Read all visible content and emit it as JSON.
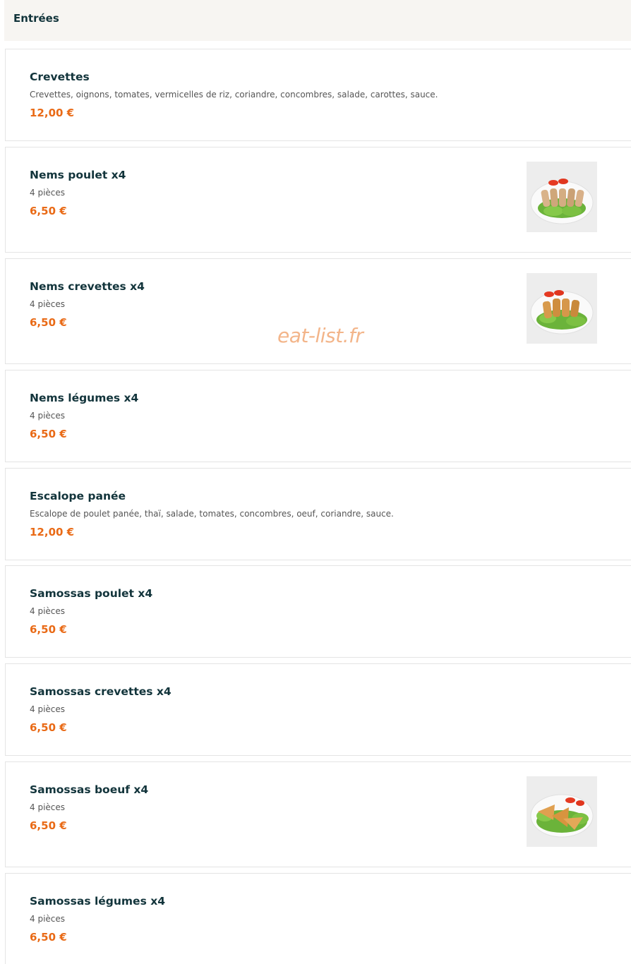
{
  "section": {
    "title": "Entrées"
  },
  "watermark": "eat-list.fr",
  "colors": {
    "accent": "#e96a16",
    "title": "#12343b",
    "header_bg": "#f7f5f2"
  },
  "items": [
    {
      "name": "Crevettes",
      "description": "Crevettes, oignons, tomates, vermicelles de riz, coriandre, concombres, salade, carottes, sauce.",
      "price": "12,00 €",
      "image": "none"
    },
    {
      "name": "Nems poulet x4",
      "description": "4 pièces",
      "price": "6,50 €",
      "image": "nems-poulet-photo"
    },
    {
      "name": "Nems crevettes x4",
      "description": "4 pièces",
      "price": "6,50 €",
      "image": "nems-crevettes-photo"
    },
    {
      "name": "Nems légumes x4",
      "description": "4 pièces",
      "price": "6,50 €",
      "image": "none"
    },
    {
      "name": "Escalope panée",
      "description": "Escalope de poulet panée, thaï, salade, tomates, concombres, oeuf, coriandre, sauce.",
      "price": "12,00 €",
      "image": "none"
    },
    {
      "name": "Samossas poulet x4",
      "description": "4 pièces",
      "price": "6,50 €",
      "image": "none"
    },
    {
      "name": "Samossas crevettes x4",
      "description": "4 pièces",
      "price": "6,50 €",
      "image": "none"
    },
    {
      "name": "Samossas boeuf x4",
      "description": "4 pièces",
      "price": "6,50 €",
      "image": "samossas-boeuf-photo"
    },
    {
      "name": "Samossas légumes x4",
      "description": "4 pièces",
      "price": "6,50 €",
      "image": "none"
    }
  ]
}
